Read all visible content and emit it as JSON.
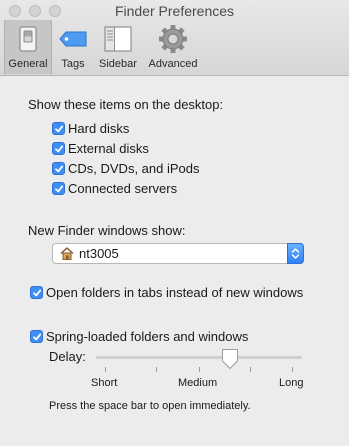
{
  "window": {
    "title": "Finder Preferences"
  },
  "tabs": [
    {
      "label": "General",
      "icon": "general-switch-icon",
      "selected": true
    },
    {
      "label": "Tags",
      "icon": "tag-icon",
      "selected": false
    },
    {
      "label": "Sidebar",
      "icon": "sidebar-icon",
      "selected": false
    },
    {
      "label": "Advanced",
      "icon": "gear-icon",
      "selected": false
    }
  ],
  "desktop": {
    "heading": "Show these items on the desktop:",
    "items": [
      {
        "label": "Hard disks",
        "checked": true
      },
      {
        "label": "External disks",
        "checked": true
      },
      {
        "label": "CDs, DVDs, and iPods",
        "checked": true
      },
      {
        "label": "Connected servers",
        "checked": true
      }
    ]
  },
  "new_window": {
    "heading": "New Finder windows show:",
    "selected": "nt3005",
    "icon": "home-icon"
  },
  "open_tabs": {
    "label": "Open folders in tabs instead of new windows",
    "checked": true
  },
  "spring": {
    "label": "Spring-loaded folders and windows",
    "checked": true,
    "delay_label": "Delay:",
    "min_label": "Short",
    "mid_label": "Medium",
    "max_label": "Long",
    "value_fraction": 0.65,
    "note": "Press the space bar to open immediately."
  },
  "colors": {
    "accent": "#3f8ef6",
    "window_bg": "#ececec"
  }
}
